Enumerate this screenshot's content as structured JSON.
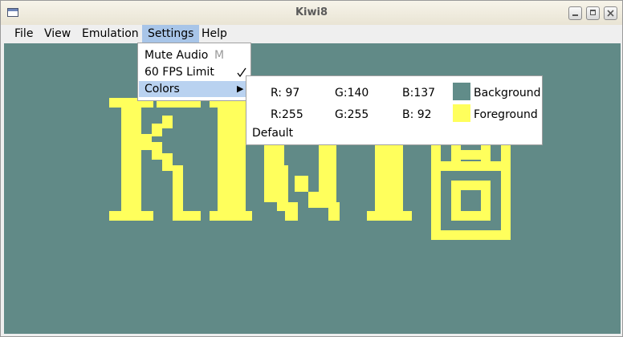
{
  "window": {
    "title": "Kiwi8"
  },
  "menubar": {
    "items": [
      "File",
      "View",
      "Emulation",
      "Settings",
      "Help"
    ]
  },
  "settings_menu": {
    "mute_audio": "Mute Audio",
    "mute_shortcut": "M",
    "fps_limit": "60 FPS Limit",
    "fps_checked": true,
    "colors": "Colors"
  },
  "colors_submenu": {
    "background": {
      "r": "R: 97",
      "g": "G:140",
      "b": "B:137",
      "label": "Background",
      "hex": "#618c89"
    },
    "foreground": {
      "r": "R:255",
      "g": "G:255",
      "b": "B: 92",
      "label": "Foreground",
      "hex": "#ffff5c"
    },
    "default": "Default"
  },
  "display": {
    "background_color": "#618a87",
    "pixel_color": "#ffff5c",
    "logo": "KIWI8"
  }
}
